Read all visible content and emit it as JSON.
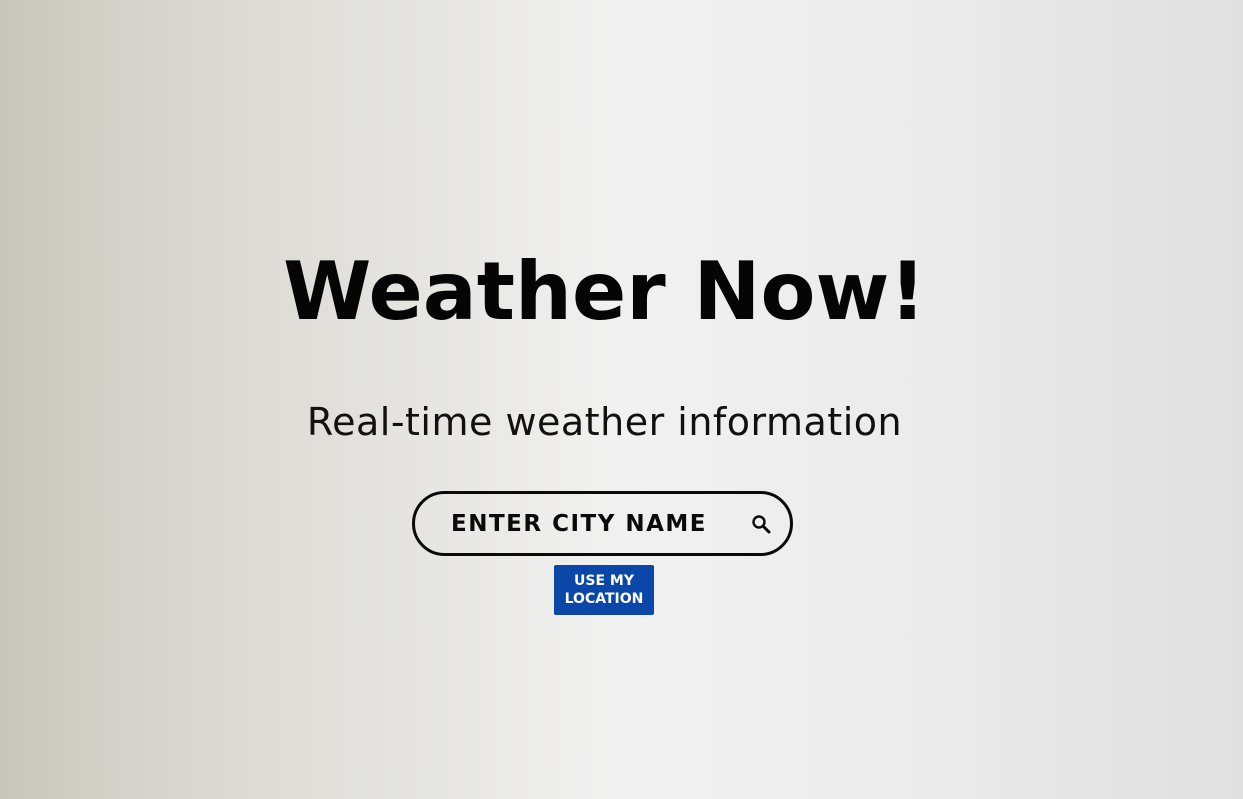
{
  "hero": {
    "title": "Weather Now!",
    "subtitle": "Real-time weather information"
  },
  "search": {
    "placeholder": "ENTER CITY NAME",
    "button_icon": "search-icon"
  },
  "location_button": {
    "line1": "USE MY",
    "line2": "LOCATION"
  },
  "colors": {
    "accent": "#0b47a8",
    "text": "#050505"
  }
}
